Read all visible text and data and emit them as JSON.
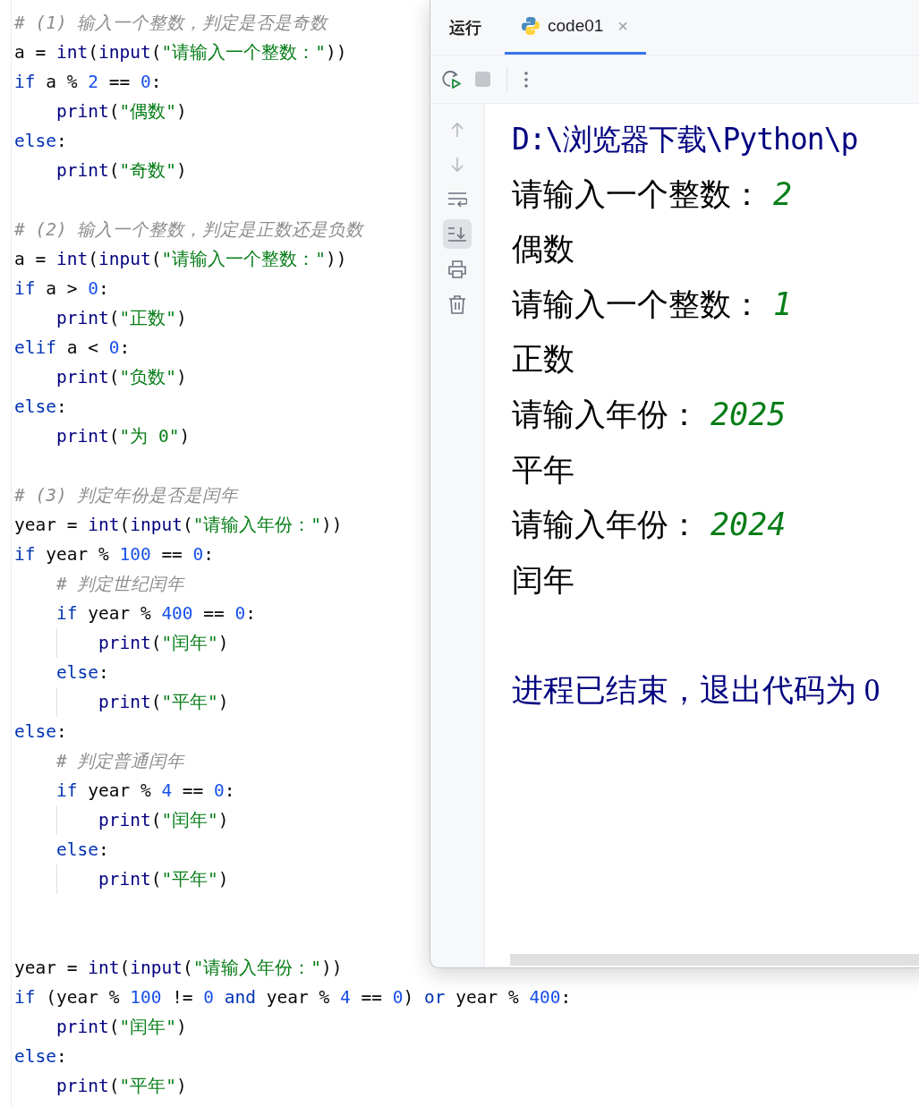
{
  "editor": {
    "lines": [
      {
        "kind": "code",
        "guide": false,
        "tokens": [
          {
            "kind": "comment",
            "text": "# (1) 输入一个整数，判定是否是奇数"
          }
        ]
      },
      {
        "kind": "code",
        "guide": false,
        "tokens": [
          {
            "kind": "plain",
            "text": "a = "
          },
          {
            "kind": "func",
            "text": "int"
          },
          {
            "kind": "plain",
            "text": "("
          },
          {
            "kind": "func",
            "text": "input"
          },
          {
            "kind": "plain",
            "text": "("
          },
          {
            "kind": "string",
            "text": "\"请输入一个整数：\""
          },
          {
            "kind": "plain",
            "text": "))"
          }
        ]
      },
      {
        "kind": "code",
        "guide": false,
        "tokens": [
          {
            "kind": "kw",
            "text": "if"
          },
          {
            "kind": "plain",
            "text": " a % "
          },
          {
            "kind": "num",
            "text": "2"
          },
          {
            "kind": "plain",
            "text": " == "
          },
          {
            "kind": "num",
            "text": "0"
          },
          {
            "kind": "plain",
            "text": ":"
          }
        ]
      },
      {
        "kind": "code",
        "guide": false,
        "tokens": [
          {
            "kind": "func",
            "text": "    print"
          },
          {
            "kind": "plain",
            "text": "("
          },
          {
            "kind": "string",
            "text": "\"偶数\""
          },
          {
            "kind": "plain",
            "text": ")"
          }
        ]
      },
      {
        "kind": "code",
        "guide": false,
        "tokens": [
          {
            "kind": "kw",
            "text": "else"
          },
          {
            "kind": "plain",
            "text": ":"
          }
        ]
      },
      {
        "kind": "code",
        "guide": false,
        "tokens": [
          {
            "kind": "func",
            "text": "    print"
          },
          {
            "kind": "plain",
            "text": "("
          },
          {
            "kind": "string",
            "text": "\"奇数\""
          },
          {
            "kind": "plain",
            "text": ")"
          }
        ]
      },
      {
        "kind": "blank"
      },
      {
        "kind": "code",
        "guide": false,
        "tokens": [
          {
            "kind": "comment",
            "text": "# (2) 输入一个整数，判定是正数还是负数"
          }
        ]
      },
      {
        "kind": "code",
        "guide": false,
        "tokens": [
          {
            "kind": "plain",
            "text": "a = "
          },
          {
            "kind": "func",
            "text": "int"
          },
          {
            "kind": "plain",
            "text": "("
          },
          {
            "kind": "func",
            "text": "input"
          },
          {
            "kind": "plain",
            "text": "("
          },
          {
            "kind": "string",
            "text": "\"请输入一个整数：\""
          },
          {
            "kind": "plain",
            "text": "))"
          }
        ]
      },
      {
        "kind": "code",
        "guide": false,
        "tokens": [
          {
            "kind": "kw",
            "text": "if"
          },
          {
            "kind": "plain",
            "text": " a > "
          },
          {
            "kind": "num",
            "text": "0"
          },
          {
            "kind": "plain",
            "text": ":"
          }
        ]
      },
      {
        "kind": "code",
        "guide": false,
        "tokens": [
          {
            "kind": "func",
            "text": "    print"
          },
          {
            "kind": "plain",
            "text": "("
          },
          {
            "kind": "string",
            "text": "\"正数\""
          },
          {
            "kind": "plain",
            "text": ")"
          }
        ]
      },
      {
        "kind": "code",
        "guide": false,
        "tokens": [
          {
            "kind": "kw",
            "text": "elif"
          },
          {
            "kind": "plain",
            "text": " a < "
          },
          {
            "kind": "num",
            "text": "0"
          },
          {
            "kind": "plain",
            "text": ":"
          }
        ]
      },
      {
        "kind": "code",
        "guide": false,
        "tokens": [
          {
            "kind": "func",
            "text": "    print"
          },
          {
            "kind": "plain",
            "text": "("
          },
          {
            "kind": "string",
            "text": "\"负数\""
          },
          {
            "kind": "plain",
            "text": ")"
          }
        ]
      },
      {
        "kind": "code",
        "guide": false,
        "tokens": [
          {
            "kind": "kw",
            "text": "else"
          },
          {
            "kind": "plain",
            "text": ":"
          }
        ]
      },
      {
        "kind": "code",
        "guide": false,
        "tokens": [
          {
            "kind": "func",
            "text": "    print"
          },
          {
            "kind": "plain",
            "text": "("
          },
          {
            "kind": "string",
            "text": "\"为 0\""
          },
          {
            "kind": "plain",
            "text": ")"
          }
        ]
      },
      {
        "kind": "blank"
      },
      {
        "kind": "code",
        "guide": false,
        "tokens": [
          {
            "kind": "comment",
            "text": "# (3) 判定年份是否是闰年"
          }
        ]
      },
      {
        "kind": "code",
        "guide": false,
        "tokens": [
          {
            "kind": "plain",
            "text": "year = "
          },
          {
            "kind": "func",
            "text": "int"
          },
          {
            "kind": "plain",
            "text": "("
          },
          {
            "kind": "func",
            "text": "input"
          },
          {
            "kind": "plain",
            "text": "("
          },
          {
            "kind": "string",
            "text": "\"请输入年份：\""
          },
          {
            "kind": "plain",
            "text": "))"
          }
        ]
      },
      {
        "kind": "code",
        "guide": false,
        "tokens": [
          {
            "kind": "kw",
            "text": "if"
          },
          {
            "kind": "plain",
            "text": " year % "
          },
          {
            "kind": "num",
            "text": "100"
          },
          {
            "kind": "plain",
            "text": " == "
          },
          {
            "kind": "num",
            "text": "0"
          },
          {
            "kind": "plain",
            "text": ":"
          }
        ]
      },
      {
        "kind": "code",
        "guide": false,
        "tokens": [
          {
            "kind": "comment",
            "text": "    # 判定世纪闰年"
          }
        ]
      },
      {
        "kind": "code",
        "guide": false,
        "tokens": [
          {
            "kind": "kw",
            "text": "    if"
          },
          {
            "kind": "plain",
            "text": " year % "
          },
          {
            "kind": "num",
            "text": "400"
          },
          {
            "kind": "plain",
            "text": " == "
          },
          {
            "kind": "num",
            "text": "0"
          },
          {
            "kind": "plain",
            "text": ":"
          }
        ]
      },
      {
        "kind": "code",
        "guide": true,
        "tokens": [
          {
            "kind": "func",
            "text": "        print"
          },
          {
            "kind": "plain",
            "text": "("
          },
          {
            "kind": "string",
            "text": "\"闰年\""
          },
          {
            "kind": "plain",
            "text": ")"
          }
        ]
      },
      {
        "kind": "code",
        "guide": false,
        "tokens": [
          {
            "kind": "kw",
            "text": "    else"
          },
          {
            "kind": "plain",
            "text": ":"
          }
        ]
      },
      {
        "kind": "code",
        "guide": true,
        "tokens": [
          {
            "kind": "func",
            "text": "        print"
          },
          {
            "kind": "plain",
            "text": "("
          },
          {
            "kind": "string",
            "text": "\"平年\""
          },
          {
            "kind": "plain",
            "text": ")"
          }
        ]
      },
      {
        "kind": "code",
        "guide": false,
        "tokens": [
          {
            "kind": "kw",
            "text": "else"
          },
          {
            "kind": "plain",
            "text": ":"
          }
        ]
      },
      {
        "kind": "code",
        "guide": false,
        "tokens": [
          {
            "kind": "comment",
            "text": "    # 判定普通闰年"
          }
        ]
      },
      {
        "kind": "code",
        "guide": false,
        "tokens": [
          {
            "kind": "kw",
            "text": "    if"
          },
          {
            "kind": "plain",
            "text": " year % "
          },
          {
            "kind": "num",
            "text": "4"
          },
          {
            "kind": "plain",
            "text": " == "
          },
          {
            "kind": "num",
            "text": "0"
          },
          {
            "kind": "plain",
            "text": ":"
          }
        ]
      },
      {
        "kind": "code",
        "guide": true,
        "tokens": [
          {
            "kind": "func",
            "text": "        print"
          },
          {
            "kind": "plain",
            "text": "("
          },
          {
            "kind": "string",
            "text": "\"闰年\""
          },
          {
            "kind": "plain",
            "text": ")"
          }
        ]
      },
      {
        "kind": "code",
        "guide": false,
        "tokens": [
          {
            "kind": "kw",
            "text": "    else"
          },
          {
            "kind": "plain",
            "text": ":"
          }
        ]
      },
      {
        "kind": "code",
        "guide": true,
        "tokens": [
          {
            "kind": "func",
            "text": "        print"
          },
          {
            "kind": "plain",
            "text": "("
          },
          {
            "kind": "string",
            "text": "\"平年\""
          },
          {
            "kind": "plain",
            "text": ")"
          }
        ]
      },
      {
        "kind": "blank"
      },
      {
        "kind": "blank"
      },
      {
        "kind": "code",
        "guide": false,
        "tokens": [
          {
            "kind": "plain",
            "text": "year = "
          },
          {
            "kind": "func",
            "text": "int"
          },
          {
            "kind": "plain",
            "text": "("
          },
          {
            "kind": "func",
            "text": "input"
          },
          {
            "kind": "plain",
            "text": "("
          },
          {
            "kind": "string",
            "text": "\"请输入年份：\""
          },
          {
            "kind": "plain",
            "text": "))"
          }
        ]
      },
      {
        "kind": "code",
        "guide": false,
        "tokens": [
          {
            "kind": "kw",
            "text": "if"
          },
          {
            "kind": "plain",
            "text": " (year % "
          },
          {
            "kind": "num",
            "text": "100"
          },
          {
            "kind": "plain",
            "text": " != "
          },
          {
            "kind": "num",
            "text": "0"
          },
          {
            "kind": "kw",
            "text": " and"
          },
          {
            "kind": "plain",
            "text": " year % "
          },
          {
            "kind": "num",
            "text": "4"
          },
          {
            "kind": "plain",
            "text": " == "
          },
          {
            "kind": "num",
            "text": "0"
          },
          {
            "kind": "plain",
            "text": ")"
          },
          {
            "kind": "kw",
            "text": " or"
          },
          {
            "kind": "plain",
            "text": " year % "
          },
          {
            "kind": "num",
            "text": "400"
          },
          {
            "kind": "plain",
            "text": ":"
          }
        ]
      },
      {
        "kind": "code",
        "guide": false,
        "tokens": [
          {
            "kind": "func",
            "text": "    print"
          },
          {
            "kind": "plain",
            "text": "("
          },
          {
            "kind": "string",
            "text": "\"闰年\""
          },
          {
            "kind": "plain",
            "text": ")"
          }
        ]
      },
      {
        "kind": "code",
        "guide": false,
        "tokens": [
          {
            "kind": "kw",
            "text": "else"
          },
          {
            "kind": "plain",
            "text": ":"
          }
        ]
      },
      {
        "kind": "code",
        "guide": false,
        "tokens": [
          {
            "kind": "func",
            "text": "    print"
          },
          {
            "kind": "plain",
            "text": "("
          },
          {
            "kind": "string",
            "text": "\"平年\""
          },
          {
            "kind": "plain",
            "text": ")"
          }
        ]
      }
    ]
  },
  "run_panel": {
    "title": "运行",
    "tabs": [
      {
        "label": "code01",
        "selected": true,
        "close": "×"
      }
    ],
    "toolbar": {
      "stop_disabled": true
    },
    "side_tools": [
      {
        "kind": "up",
        "active": false
      },
      {
        "kind": "down",
        "active": false
      },
      {
        "kind": "wrap",
        "active": false
      },
      {
        "kind": "scroll-end",
        "active": true
      },
      {
        "kind": "print",
        "active": false
      },
      {
        "kind": "trash",
        "active": false
      }
    ],
    "console": [
      {
        "kind": "path",
        "text": "D:\\浏览器下载\\Python\\p"
      },
      {
        "kind": "prompt",
        "text": "请输入一个整数：",
        "input": "2"
      },
      {
        "kind": "output",
        "text": "偶数"
      },
      {
        "kind": "prompt",
        "text": "请输入一个整数：",
        "input": "1"
      },
      {
        "kind": "output",
        "text": "正数"
      },
      {
        "kind": "prompt",
        "text": "请输入年份：",
        "input": "2025"
      },
      {
        "kind": "output",
        "text": "平年"
      },
      {
        "kind": "prompt",
        "text": "请输入年份：",
        "input": "2024"
      },
      {
        "kind": "output",
        "text": "闰年"
      },
      {
        "kind": "blank"
      },
      {
        "kind": "exit",
        "text": "进程已结束，退出代码为 0"
      }
    ]
  }
}
